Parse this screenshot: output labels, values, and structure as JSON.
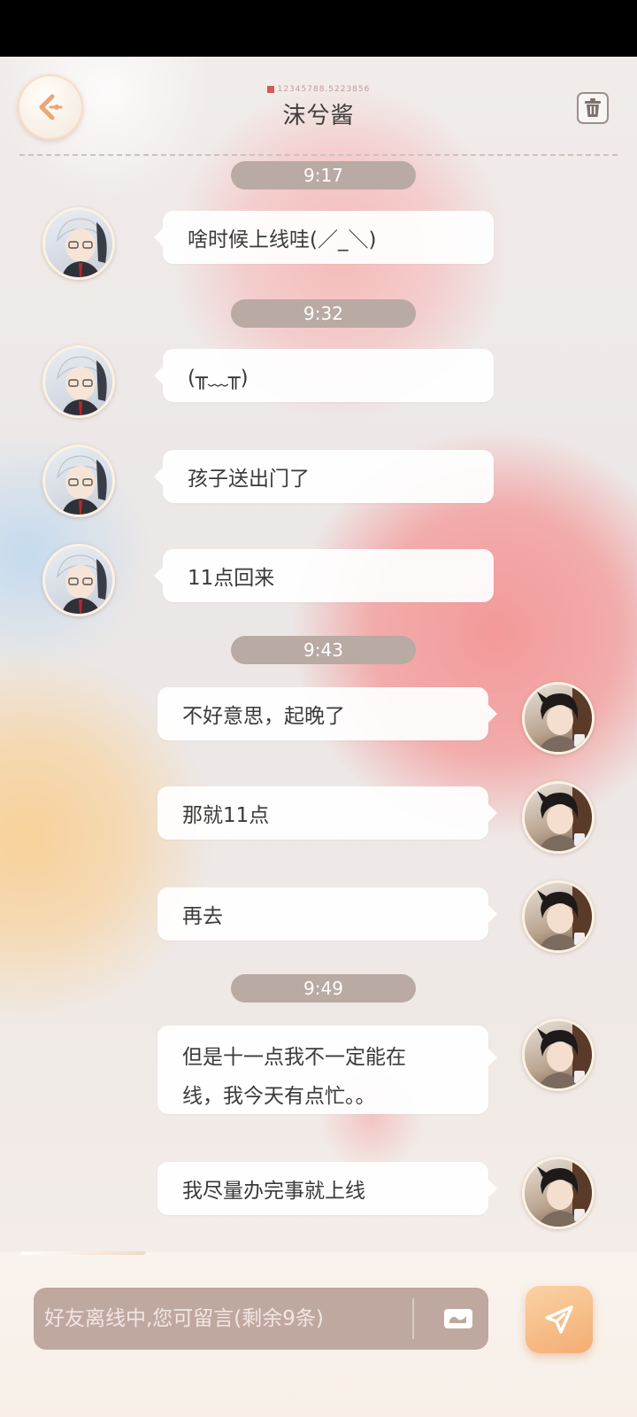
{
  "header": {
    "uid_text": "12345788.5223856",
    "title": "沫兮酱"
  },
  "times": [
    "9:17",
    "9:32",
    "9:43",
    "9:49"
  ],
  "messages": [
    {
      "side": "left",
      "text": "啥时候上线哇(／_＼)"
    },
    {
      "side": "left",
      "text": "(╥﹏╥)"
    },
    {
      "side": "left",
      "text": "孩子送出门了"
    },
    {
      "side": "left",
      "text": "11点回来"
    },
    {
      "side": "right",
      "text": "不好意思，起晚了"
    },
    {
      "side": "right",
      "text": "那就11点"
    },
    {
      "side": "right",
      "text": "再去"
    },
    {
      "side": "right",
      "text_line1": "但是十一点我不一定能在",
      "text_line2": "线，我今天有点忙。。"
    },
    {
      "side": "right",
      "text": "我尽量办完事就上线"
    }
  ],
  "input": {
    "placeholder": "好友离线中,您可留言(剩余9条)"
  },
  "icons": {
    "back": "back-arrow-icon",
    "trash": "trash-icon",
    "card": "card-icon",
    "send": "send-icon"
  },
  "colors": {
    "time_pill": "#b9aaa3",
    "input_bg": "#bfa8a0",
    "send_button": "#f3ad73"
  }
}
